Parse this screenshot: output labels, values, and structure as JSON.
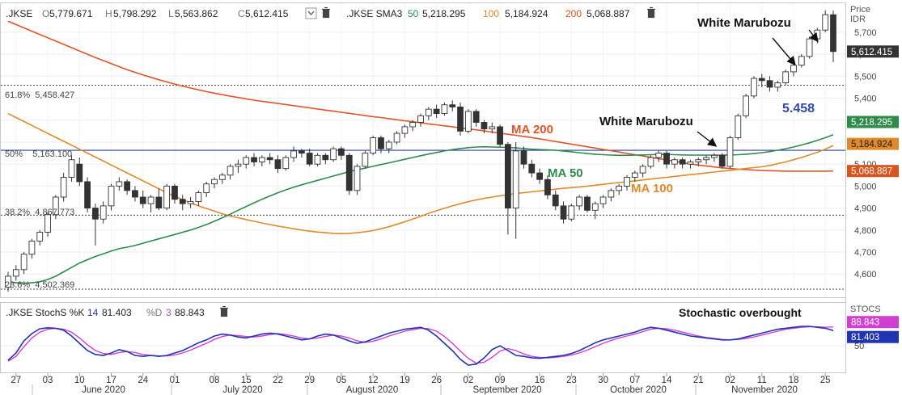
{
  "colors": {
    "candle_up_fill": "#ffffff",
    "candle_down_fill": "#333333",
    "candle_outline": "#333333",
    "ma50": "#2e8b4a",
    "ma100": "#e08a2a",
    "ma200": "#e0542a",
    "fib_line": "#2c3ea8",
    "stoch_k": "#2034b0",
    "stoch_d": "#d040d0",
    "price_tag_bg": "#333333",
    "ma50_tag": "#2e8b4a",
    "ma100_tag": "#e08a2a",
    "ma200_tag": "#d9541e",
    "stoch_d_tag": "#d040d0",
    "stoch_k_tag": "#2034b0"
  },
  "price_header": {
    "symbol": ".JKSE",
    "o_label": "O",
    "o_value": "5,779.671",
    "h_label": "H",
    "h_value": "5,798.292",
    "l_label": "L",
    "l_value": "5,563.862",
    "c_label": "C",
    "c_value": "5,612.415",
    "dropdown_icon": "chevron-down-icon",
    "delete_icon": "trash-icon"
  },
  "sma_header": {
    "label": ".JKSE SMA3",
    "p1": "50",
    "v1": "5,218.295",
    "p2": "100",
    "v2": "5,184.924",
    "p3": "200",
    "v3": "5,068.887",
    "delete_icon": "trash-icon"
  },
  "stoch_header": {
    "label": ".JKSE StochS %K",
    "k_period": "14",
    "k_value": "81.403",
    "d_label": "%D",
    "d_period": "3",
    "d_value": "88.843",
    "delete_icon": "trash-icon"
  },
  "price_axis": {
    "title_line1": "Price",
    "title_line2": "IDR",
    "ticks": [
      "5,700",
      "5,600",
      "5,500",
      "5,400",
      "5,300",
      "5,200",
      "5,100",
      "5,000",
      "4,900",
      "4,800",
      "4,700",
      "4,600"
    ]
  },
  "price_tags": {
    "last": "5,612.415",
    "ma50": "5,218.295",
    "ma100": "5,184.924",
    "ma200": "5,068.887"
  },
  "stoch_axis": {
    "title": "STOCS",
    "ticks": [
      "50"
    ]
  },
  "stoch_tags": {
    "d": "88.843",
    "k": "81.403"
  },
  "fib_labels": {
    "f618": "61.8%  5,458.427",
    "f50": "50%    5,163.100",
    "f382": "38.2%  4,867.773",
    "f236": "23.6%  4,502.369"
  },
  "annotations": {
    "white_marubozu_top": "White Marubozu",
    "white_marubozu_mid": "White Marubozu",
    "level_5458": "5.458",
    "ma200": "MA 200",
    "ma50": "MA 50",
    "ma100": "MA 100",
    "stoch_overbought": "Stochastic overbought"
  },
  "x_axis": {
    "day_ticks": [
      "27",
      "03",
      "10",
      "17",
      "24",
      "01",
      "08",
      "15",
      "22",
      "29",
      "05",
      "12",
      "19",
      "26",
      "02",
      "09",
      "16",
      "23",
      "30",
      "07",
      "14",
      "21",
      "02",
      "11",
      "18",
      "25"
    ],
    "month_labels": [
      "June 2020",
      "July 2020",
      "August 2020",
      "September 2020",
      "October 2020",
      "November 2020"
    ]
  },
  "chart_data": {
    "type": "candlestick",
    "ylim": [
      4520,
      5810
    ],
    "stoch_ylim": [
      0,
      100
    ],
    "candles": [
      {
        "o": 4540,
        "h": 4610,
        "l": 4520,
        "c": 4590
      },
      {
        "o": 4590,
        "h": 4640,
        "l": 4570,
        "c": 4620
      },
      {
        "o": 4620,
        "h": 4700,
        "l": 4600,
        "c": 4690
      },
      {
        "o": 4690,
        "h": 4760,
        "l": 4670,
        "c": 4750
      },
      {
        "o": 4750,
        "h": 4800,
        "l": 4730,
        "c": 4790
      },
      {
        "o": 4790,
        "h": 4880,
        "l": 4770,
        "c": 4870
      },
      {
        "o": 4870,
        "h": 4960,
        "l": 4850,
        "c": 4950
      },
      {
        "o": 4950,
        "h": 5060,
        "l": 4930,
        "c": 5040
      },
      {
        "o": 5040,
        "h": 5140,
        "l": 5020,
        "c": 5120
      },
      {
        "o": 5100,
        "h": 5130,
        "l": 5000,
        "c": 5020
      },
      {
        "o": 5020,
        "h": 5040,
        "l": 4880,
        "c": 4900
      },
      {
        "o": 4900,
        "h": 4920,
        "l": 4730,
        "c": 4850
      },
      {
        "o": 4850,
        "h": 4930,
        "l": 4830,
        "c": 4910
      },
      {
        "o": 4910,
        "h": 5010,
        "l": 4890,
        "c": 5000
      },
      {
        "o": 5000,
        "h": 5040,
        "l": 4980,
        "c": 5020
      },
      {
        "o": 5020,
        "h": 5030,
        "l": 4960,
        "c": 4980
      },
      {
        "o": 4980,
        "h": 5000,
        "l": 4930,
        "c": 4950
      },
      {
        "o": 4950,
        "h": 4980,
        "l": 4900,
        "c": 4920
      },
      {
        "o": 4920,
        "h": 4960,
        "l": 4880,
        "c": 4950
      },
      {
        "o": 4950,
        "h": 4990,
        "l": 4890,
        "c": 4900
      },
      {
        "o": 4900,
        "h": 5010,
        "l": 4890,
        "c": 5000
      },
      {
        "o": 5000,
        "h": 5010,
        "l": 4920,
        "c": 4940
      },
      {
        "o": 4940,
        "h": 4960,
        "l": 4890,
        "c": 4920
      },
      {
        "o": 4920,
        "h": 4950,
        "l": 4900,
        "c": 4930
      },
      {
        "o": 4930,
        "h": 4980,
        "l": 4910,
        "c": 4970
      },
      {
        "o": 4970,
        "h": 5020,
        "l": 4950,
        "c": 5010
      },
      {
        "o": 5010,
        "h": 5040,
        "l": 4990,
        "c": 5030
      },
      {
        "o": 5030,
        "h": 5060,
        "l": 5010,
        "c": 5050
      },
      {
        "o": 5050,
        "h": 5100,
        "l": 5030,
        "c": 5090
      },
      {
        "o": 5090,
        "h": 5120,
        "l": 5060,
        "c": 5100
      },
      {
        "o": 5100,
        "h": 5140,
        "l": 5080,
        "c": 5130
      },
      {
        "o": 5130,
        "h": 5150,
        "l": 5090,
        "c": 5110
      },
      {
        "o": 5110,
        "h": 5140,
        "l": 5090,
        "c": 5130
      },
      {
        "o": 5130,
        "h": 5150,
        "l": 5100,
        "c": 5120
      },
      {
        "o": 5120,
        "h": 5140,
        "l": 5060,
        "c": 5080
      },
      {
        "o": 5080,
        "h": 5140,
        "l": 5070,
        "c": 5130
      },
      {
        "o": 5130,
        "h": 5180,
        "l": 5110,
        "c": 5160
      },
      {
        "o": 5160,
        "h": 5170,
        "l": 5130,
        "c": 5150
      },
      {
        "o": 5150,
        "h": 5170,
        "l": 5090,
        "c": 5100
      },
      {
        "o": 5100,
        "h": 5150,
        "l": 5090,
        "c": 5140
      },
      {
        "o": 5140,
        "h": 5150,
        "l": 5100,
        "c": 5120
      },
      {
        "o": 5120,
        "h": 5180,
        "l": 5110,
        "c": 5170
      },
      {
        "o": 5170,
        "h": 5180,
        "l": 5120,
        "c": 5140
      },
      {
        "o": 5140,
        "h": 5150,
        "l": 4960,
        "c": 4980
      },
      {
        "o": 4980,
        "h": 5100,
        "l": 4960,
        "c": 5090
      },
      {
        "o": 5090,
        "h": 5160,
        "l": 5080,
        "c": 5150
      },
      {
        "o": 5150,
        "h": 5230,
        "l": 5140,
        "c": 5220
      },
      {
        "o": 5220,
        "h": 5230,
        "l": 5150,
        "c": 5170
      },
      {
        "o": 5170,
        "h": 5210,
        "l": 5150,
        "c": 5200
      },
      {
        "o": 5200,
        "h": 5250,
        "l": 5190,
        "c": 5240
      },
      {
        "o": 5240,
        "h": 5280,
        "l": 5220,
        "c": 5270
      },
      {
        "o": 5270,
        "h": 5300,
        "l": 5250,
        "c": 5290
      },
      {
        "o": 5290,
        "h": 5330,
        "l": 5270,
        "c": 5320
      },
      {
        "o": 5320,
        "h": 5360,
        "l": 5300,
        "c": 5350
      },
      {
        "o": 5350,
        "h": 5370,
        "l": 5310,
        "c": 5330
      },
      {
        "o": 5330,
        "h": 5380,
        "l": 5320,
        "c": 5370
      },
      {
        "o": 5370,
        "h": 5390,
        "l": 5340,
        "c": 5360
      },
      {
        "o": 5360,
        "h": 5380,
        "l": 5230,
        "c": 5250
      },
      {
        "o": 5250,
        "h": 5350,
        "l": 5240,
        "c": 5340
      },
      {
        "o": 5340,
        "h": 5350,
        "l": 5270,
        "c": 5290
      },
      {
        "o": 5290,
        "h": 5300,
        "l": 5240,
        "c": 5260
      },
      {
        "o": 5260,
        "h": 5290,
        "l": 5240,
        "c": 5270
      },
      {
        "o": 5270,
        "h": 5280,
        "l": 5180,
        "c": 5190
      },
      {
        "o": 5190,
        "h": 5200,
        "l": 4780,
        "c": 4900
      },
      {
        "o": 4900,
        "h": 5200,
        "l": 4760,
        "c": 5160
      },
      {
        "o": 5160,
        "h": 5180,
        "l": 5080,
        "c": 5100
      },
      {
        "o": 5100,
        "h": 5120,
        "l": 5040,
        "c": 5060
      },
      {
        "o": 5060,
        "h": 5080,
        "l": 5010,
        "c": 5030
      },
      {
        "o": 5030,
        "h": 5050,
        "l": 4940,
        "c": 4960
      },
      {
        "o": 4960,
        "h": 4980,
        "l": 4890,
        "c": 4910
      },
      {
        "o": 4910,
        "h": 4930,
        "l": 4830,
        "c": 4850
      },
      {
        "o": 4850,
        "h": 4920,
        "l": 4840,
        "c": 4910
      },
      {
        "o": 4910,
        "h": 4960,
        "l": 4890,
        "c": 4950
      },
      {
        "o": 4950,
        "h": 4960,
        "l": 4880,
        "c": 4890
      },
      {
        "o": 4890,
        "h": 4930,
        "l": 4850,
        "c": 4920
      },
      {
        "o": 4920,
        "h": 4960,
        "l": 4900,
        "c": 4950
      },
      {
        "o": 4950,
        "h": 4990,
        "l": 4930,
        "c": 4980
      },
      {
        "o": 4980,
        "h": 5010,
        "l": 4960,
        "c": 5000
      },
      {
        "o": 5000,
        "h": 5050,
        "l": 4980,
        "c": 5040
      },
      {
        "o": 5040,
        "h": 5070,
        "l": 5020,
        "c": 5060
      },
      {
        "o": 5060,
        "h": 5100,
        "l": 5040,
        "c": 5090
      },
      {
        "o": 5090,
        "h": 5140,
        "l": 5080,
        "c": 5130
      },
      {
        "o": 5130,
        "h": 5160,
        "l": 5110,
        "c": 5150
      },
      {
        "o": 5150,
        "h": 5160,
        "l": 5080,
        "c": 5100
      },
      {
        "o": 5100,
        "h": 5130,
        "l": 5080,
        "c": 5120
      },
      {
        "o": 5120,
        "h": 5130,
        "l": 5080,
        "c": 5100
      },
      {
        "o": 5100,
        "h": 5120,
        "l": 5080,
        "c": 5110
      },
      {
        "o": 5110,
        "h": 5130,
        "l": 5090,
        "c": 5120
      },
      {
        "o": 5120,
        "h": 5140,
        "l": 5100,
        "c": 5130
      },
      {
        "o": 5130,
        "h": 5150,
        "l": 5110,
        "c": 5140
      },
      {
        "o": 5140,
        "h": 5150,
        "l": 5080,
        "c": 5090
      },
      {
        "o": 5090,
        "h": 5230,
        "l": 5080,
        "c": 5220
      },
      {
        "o": 5220,
        "h": 5330,
        "l": 5210,
        "c": 5320
      },
      {
        "o": 5320,
        "h": 5420,
        "l": 5310,
        "c": 5410
      },
      {
        "o": 5410,
        "h": 5500,
        "l": 5400,
        "c": 5490
      },
      {
        "o": 5490,
        "h": 5510,
        "l": 5450,
        "c": 5480
      },
      {
        "o": 5480,
        "h": 5500,
        "l": 5430,
        "c": 5450
      },
      {
        "o": 5450,
        "h": 5480,
        "l": 5430,
        "c": 5470
      },
      {
        "o": 5470,
        "h": 5530,
        "l": 5460,
        "c": 5520
      },
      {
        "o": 5520,
        "h": 5560,
        "l": 5500,
        "c": 5550
      },
      {
        "o": 5550,
        "h": 5600,
        "l": 5540,
        "c": 5590
      },
      {
        "o": 5590,
        "h": 5680,
        "l": 5580,
        "c": 5670
      },
      {
        "o": 5670,
        "h": 5720,
        "l": 5650,
        "c": 5710
      },
      {
        "o": 5710,
        "h": 5800,
        "l": 5700,
        "c": 5780
      },
      {
        "o": 5779.671,
        "h": 5798.292,
        "l": 5563.862,
        "c": 5612.415
      }
    ],
    "ma50": [
      4565,
      4560,
      4558,
      4560,
      4565,
      4575,
      4590,
      4610,
      4630,
      4650,
      4665,
      4680,
      4692,
      4705,
      4715,
      4722,
      4730,
      4740,
      4750,
      4760,
      4770,
      4780,
      4790,
      4800,
      4812,
      4825,
      4840,
      4856,
      4872,
      4890,
      4907,
      4924,
      4940,
      4955,
      4970,
      4983,
      4995,
      5006,
      5016,
      5026,
      5036,
      5046,
      5056,
      5066,
      5074,
      5082,
      5090,
      5098,
      5106,
      5114,
      5122,
      5130,
      5138,
      5146,
      5153,
      5160,
      5166,
      5171,
      5175,
      5178,
      5179,
      5178,
      5177,
      5176,
      5174,
      5171,
      5168,
      5166,
      5165,
      5163,
      5160,
      5156,
      5152,
      5148,
      5145,
      5143,
      5141,
      5140,
      5140,
      5141,
      5142,
      5143,
      5144,
      5144,
      5143,
      5142,
      5141,
      5141,
      5141,
      5141,
      5141,
      5142,
      5143,
      5145,
      5148,
      5152,
      5157,
      5163,
      5170,
      5178,
      5187,
      5197,
      5208,
      5220,
      5234
    ],
    "ma100": [
      5330,
      5312,
      5294,
      5276,
      5258,
      5240,
      5222,
      5204,
      5186,
      5168,
      5150,
      5132,
      5114,
      5096,
      5078,
      5060,
      5042,
      5024,
      5006,
      4988,
      4970,
      4954,
      4938,
      4924,
      4910,
      4898,
      4886,
      4874,
      4864,
      4856,
      4848,
      4840,
      4832,
      4825,
      4818,
      4812,
      4806,
      4800,
      4795,
      4791,
      4788,
      4785,
      4784,
      4785,
      4788,
      4792,
      4798,
      4806,
      4815,
      4826,
      4838,
      4850,
      4863,
      4876,
      4888,
      4899,
      4910,
      4920,
      4929,
      4937,
      4944,
      4950,
      4956,
      4961,
      4966,
      4970,
      4974,
      4978,
      4982,
      4986,
      4990,
      4993,
      4996,
      5000,
      5004,
      5008,
      5012,
      5016,
      5020,
      5024,
      5028,
      5032,
      5036,
      5040,
      5044,
      5048,
      5052,
      5056,
      5060,
      5064,
      5068,
      5072,
      5076,
      5080,
      5084,
      5088,
      5094,
      5102,
      5110,
      5120,
      5130,
      5142,
      5154,
      5168,
      5185
    ],
    "ma200": [
      5750,
      5735,
      5720,
      5705,
      5690,
      5675,
      5660,
      5645,
      5630,
      5615,
      5600,
      5585,
      5571,
      5557,
      5543,
      5530,
      5518,
      5506,
      5495,
      5484,
      5474,
      5464,
      5455,
      5446,
      5438,
      5430,
      5423,
      5416,
      5409,
      5403,
      5397,
      5391,
      5386,
      5381,
      5376,
      5371,
      5366,
      5361,
      5356,
      5351,
      5346,
      5341,
      5336,
      5331,
      5326,
      5321,
      5316,
      5312,
      5307,
      5302,
      5297,
      5293,
      5288,
      5283,
      5279,
      5274,
      5270,
      5265,
      5260,
      5256,
      5251,
      5246,
      5241,
      5236,
      5231,
      5226,
      5221,
      5215,
      5209,
      5203,
      5197,
      5191,
      5185,
      5179,
      5173,
      5167,
      5161,
      5155,
      5149,
      5143,
      5137,
      5131,
      5125,
      5119,
      5113,
      5107,
      5101,
      5096,
      5091,
      5087,
      5083,
      5080,
      5077,
      5075,
      5073,
      5071,
      5070,
      5069,
      5068,
      5068,
      5068,
      5068,
      5068,
      5068,
      5068.887
    ],
    "fib_levels": [
      5458.427,
      5163.1,
      4867.773,
      4502.369
    ],
    "stoch_k": [
      20,
      35,
      60,
      75,
      85,
      87,
      86,
      82,
      70,
      55,
      40,
      32,
      30,
      35,
      42,
      38,
      30,
      28,
      30,
      28,
      30,
      35,
      40,
      48,
      56,
      62,
      70,
      74,
      72,
      68,
      66,
      70,
      74,
      76,
      74,
      70,
      66,
      62,
      64,
      70,
      74,
      72,
      66,
      60,
      55,
      58,
      64,
      70,
      76,
      80,
      84,
      86,
      88,
      82,
      70,
      55,
      40,
      22,
      10,
      12,
      25,
      42,
      50,
      40,
      30,
      28,
      25,
      24,
      26,
      28,
      30,
      34,
      40,
      48,
      56,
      62,
      66,
      70,
      74,
      78,
      84,
      88,
      86,
      82,
      78,
      74,
      70,
      68,
      66,
      64,
      62,
      62,
      64,
      68,
      72,
      76,
      80,
      84,
      86,
      88,
      90,
      90,
      88,
      86,
      81.403
    ],
    "stoch_d": [
      18,
      28,
      48,
      66,
      78,
      84,
      86,
      84,
      78,
      66,
      52,
      40,
      34,
      32,
      36,
      38,
      36,
      32,
      30,
      29,
      29,
      31,
      35,
      41,
      48,
      55,
      63,
      69,
      72,
      71,
      69,
      68,
      70,
      73,
      75,
      73,
      70,
      66,
      64,
      66,
      69,
      72,
      70,
      66,
      60,
      57,
      59,
      64,
      70,
      75,
      80,
      83,
      86,
      85,
      80,
      69,
      55,
      39,
      24,
      14,
      16,
      26,
      39,
      44,
      40,
      33,
      28,
      26,
      25,
      26,
      28,
      31,
      35,
      41,
      48,
      55,
      61,
      66,
      70,
      74,
      79,
      84,
      86,
      85,
      82,
      78,
      74,
      70,
      67,
      65,
      63,
      62,
      63,
      65,
      68,
      72,
      76,
      80,
      84,
      86,
      88,
      89,
      89,
      88,
      88.843
    ]
  }
}
